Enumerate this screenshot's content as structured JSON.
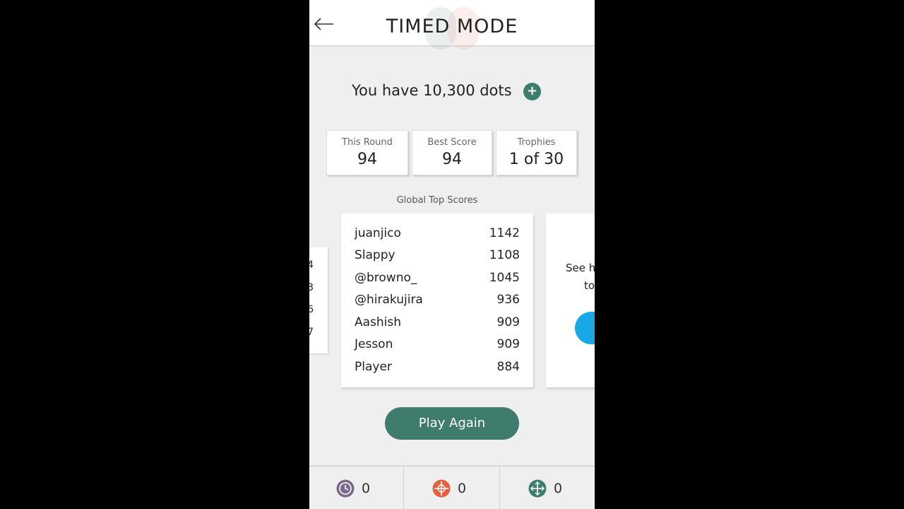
{
  "header": {
    "title": "TIMED MODE"
  },
  "dots": {
    "text": "You have 10,300 dots"
  },
  "stats": [
    {
      "label": "This Round",
      "value": "94"
    },
    {
      "label": "Best Score",
      "value": "94"
    },
    {
      "label": "Trophies",
      "value": "1 of 30"
    }
  ],
  "leaderboard": {
    "title": "Global Top Scores",
    "rows": [
      {
        "name": "juanjico",
        "score": "1142"
      },
      {
        "name": "Slappy",
        "score": "1108"
      },
      {
        "name": "@browno_",
        "score": "1045"
      },
      {
        "name": "@hirakujira",
        "score": "936"
      },
      {
        "name": "Aashish",
        "score": "909"
      },
      {
        "name": "Jesson",
        "score": "909"
      },
      {
        "name": "Player",
        "score": "884"
      }
    ]
  },
  "left_card": {
    "fragments": [
      "4",
      "3",
      "6",
      "7"
    ]
  },
  "right_card": {
    "line1": "See h",
    "line2": "to"
  },
  "play_again": {
    "label": "Play Again"
  },
  "powerups": [
    {
      "icon": "clock-icon",
      "count": "0",
      "color": "#7d6a8a"
    },
    {
      "icon": "target-expand-icon",
      "count": "0",
      "color": "#e0603f"
    },
    {
      "icon": "arrows-expand-icon",
      "count": "0",
      "color": "#3f7c6e"
    }
  ]
}
